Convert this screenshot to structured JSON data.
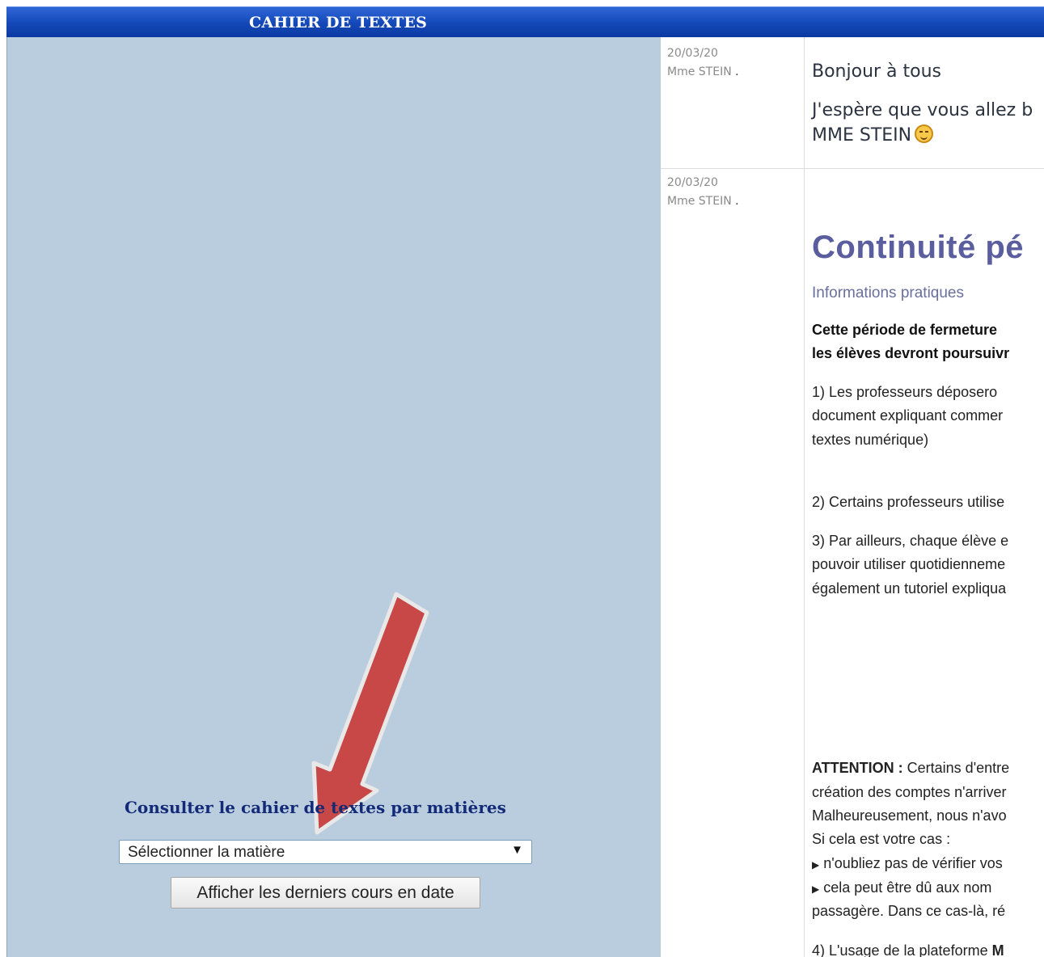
{
  "header": {
    "title": "CAHIER DE TEXTES"
  },
  "sidebar": {
    "consult_title": "Consulter le cahier de textes par matières",
    "select": {
      "selected": "Sélectionner la matière"
    },
    "latest_button": "Afficher les derniers cours en date"
  },
  "annotation": {
    "arrow_color": "#c84848",
    "icon": "red-arrow-icon"
  },
  "entries": [
    {
      "date": "20/03/20",
      "author": "Mme STEIN",
      "dot": ".",
      "lines": [
        "Bonjour à tous",
        "J'espère que vous allez b",
        "MME STEIN"
      ],
      "emoji": "smiley-icon"
    },
    {
      "date": "20/03/20",
      "author": "Mme STEIN",
      "dot": ".",
      "title": "Continuité pé",
      "subtitle": "Informations pratiques",
      "bold_lines": [
        "Cette période de fermeture",
        "les élèves devront poursuivr"
      ],
      "p1": [
        "1) Les professeurs déposero",
        "document expliquant commer",
        "textes numérique)"
      ],
      "p2": "2) Certains professeurs utilise",
      "p3": [
        "3) Par ailleurs, chaque élève e",
        "pouvoir utiliser quotidienneme",
        "également un tutoriel expliqua"
      ],
      "attention_label": "ATTENTION :",
      "attention_rest": " Certains d'entre",
      "attention_lines": [
        "création des comptes n'arriver",
        "Malheureusement, nous n'avo",
        "Si cela est votre cas :"
      ],
      "bullets": [
        "n'oubliez pas de vérifier vos",
        "cela peut être dû aux nom"
      ],
      "bullet_cont": "passagère. Dans ce cas-là, ré",
      "p4_start": "4) L'usage de la plateforme ",
      "p4_bold": "M"
    }
  ]
}
